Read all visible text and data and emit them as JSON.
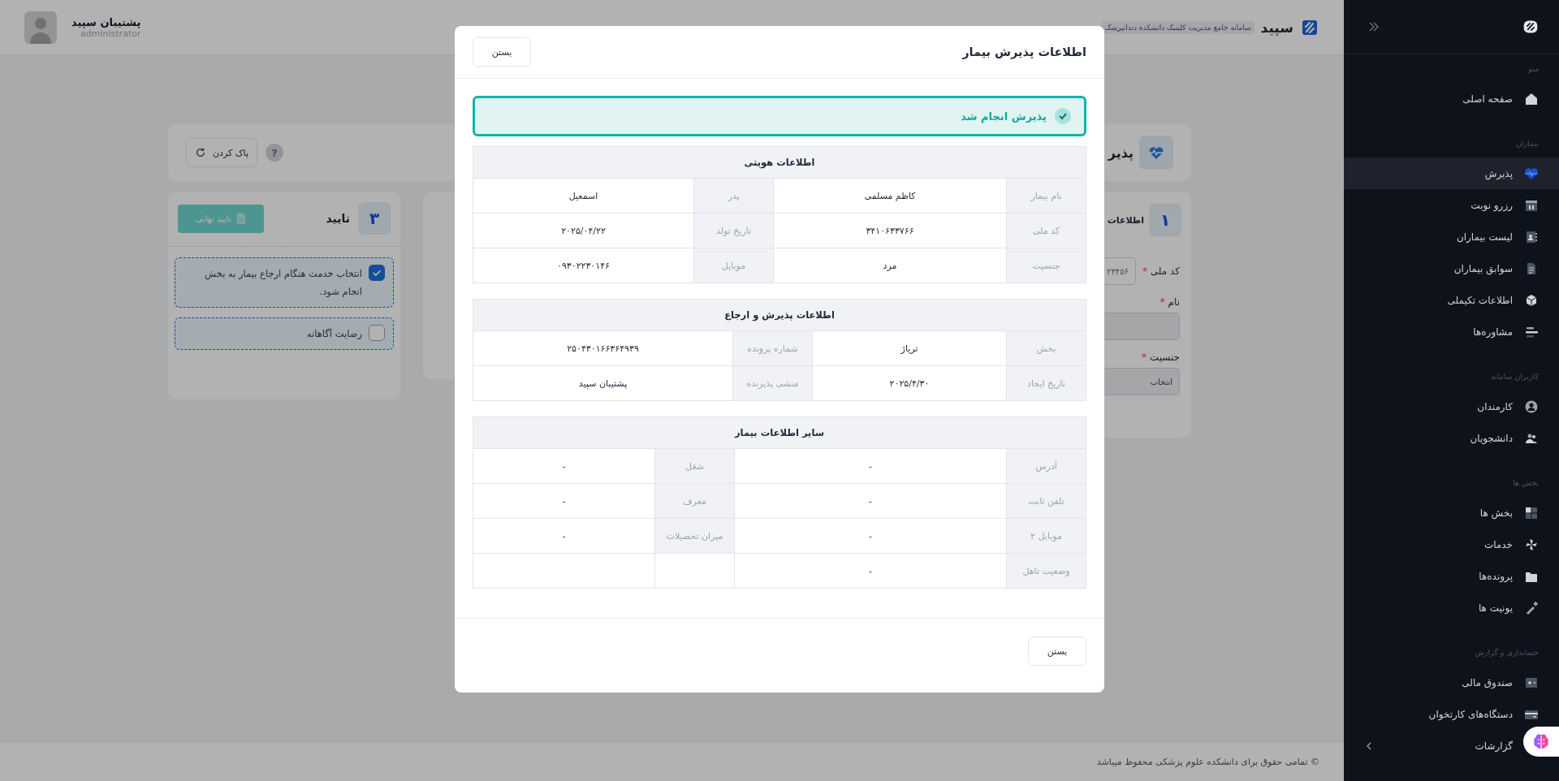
{
  "header": {
    "brand": "سپید",
    "subtitle": "سامانه جامع مدیریت کلینیک دانشکده دندانپزشک",
    "user_name": "پشتیبان سپید",
    "user_role": "administrator"
  },
  "page": {
    "title": "پذیر",
    "help": "?",
    "reset_button": "پاک کردن"
  },
  "step_confirm": {
    "number": "۳",
    "title": "تایید",
    "button": "تایید نهایی",
    "options": [
      {
        "label": "انتخاب خدمت هنگام ارجاع بیمار به بخش انجام شود.",
        "checked": true
      },
      {
        "label": "رضایت آگاهانه",
        "checked": false
      }
    ]
  },
  "step_info": {
    "number": "۱",
    "title": "اطلاعات",
    "fields": [
      {
        "kind": "inline",
        "label": "کد ملی",
        "mark": "*",
        "placeholder": "۲۳۴۵۶"
      },
      {
        "kind": "input",
        "label": "نام",
        "mark": "*"
      },
      {
        "kind": "select",
        "label": "جنسیت",
        "mark": "*",
        "value": "انتخاب"
      }
    ]
  },
  "footer": "© تمامی حقوق برای دانشکده علوم پزشکی محفوظ میباشد",
  "sidebar": {
    "sections": [
      {
        "label": "منو",
        "items": [
          {
            "label": "صفحه اصلی",
            "selected": false
          }
        ]
      },
      {
        "label": "بیماران",
        "items": [
          {
            "label": "پذیرش",
            "selected": true
          },
          {
            "label": "رزرو نوبت",
            "selected": false
          },
          {
            "label": "لیست بیماران",
            "selected": false
          },
          {
            "label": "سوابق بیماران",
            "selected": false
          },
          {
            "label": "اطلاعات تکیملی",
            "selected": false
          },
          {
            "label": "مشاوره‌ها",
            "selected": false
          }
        ]
      },
      {
        "label": "کاربران سامانه",
        "items": [
          {
            "label": "کارمندان",
            "selected": false
          },
          {
            "label": "دانشجویان",
            "selected": false
          }
        ]
      },
      {
        "label": "بخش ها",
        "items": [
          {
            "label": "بخش ها",
            "selected": false
          },
          {
            "label": "خدمات",
            "selected": false
          },
          {
            "label": "پرونده‌ها",
            "selected": false
          },
          {
            "label": "یونیت ها",
            "selected": false
          }
        ]
      },
      {
        "label": "حسابداری و گزارش",
        "items": [
          {
            "label": "صندوق مالی",
            "selected": false
          },
          {
            "label": "دستگاه‌های کارتخوان",
            "selected": false
          },
          {
            "label": "گزارشات",
            "selected": false
          }
        ]
      }
    ]
  },
  "modal": {
    "title": "اطلاعات پذیرش بیمار",
    "close_button": "بستن",
    "status": "پذیرش انجام شد",
    "sections": [
      {
        "title": "اطلاعات هویتی",
        "rows": [
          [
            {
              "label": "نام بیمار",
              "value": "کاظم مسلمی"
            },
            {
              "label": "پدر",
              "value": "اسمعیل"
            }
          ],
          [
            {
              "label": "کد ملی",
              "value": "۳۴۱۰۶۳۳۷۶۶"
            },
            {
              "label": "تاریخ تولد",
              "value": "۲۰۲۵/۰۴/۲۲"
            }
          ],
          [
            {
              "label": "جنسیت",
              "value": "مرد"
            },
            {
              "label": "موبایل",
              "value": "۰۹۳۰۲۲۳۰۱۴۶"
            }
          ]
        ]
      },
      {
        "title": "اطلاعات پذیرش و ارجاع",
        "rows": [
          [
            {
              "label": "بخش",
              "value": "تریاژ"
            },
            {
              "label": "شماره پرونده",
              "value": "۲۵۰۴۳۰۱۶۶۳۶۴۹۳۹"
            }
          ],
          [
            {
              "label": "تاریخ ایجاد",
              "value": "۲۰۲۵/۴/۳۰"
            },
            {
              "label": "منشی پذیرنده",
              "value": "پشتیبان سپید"
            }
          ]
        ]
      },
      {
        "title": "سایر اطلاعات بیمار",
        "rows": [
          [
            {
              "label": "آدرس",
              "value": "-"
            },
            {
              "label": "شغل",
              "value": "-"
            }
          ],
          [
            {
              "label": "تلفن ثابت",
              "value": "-"
            },
            {
              "label": "معرف",
              "value": "-"
            }
          ],
          [
            {
              "label": "موبایل ۲",
              "value": "-"
            },
            {
              "label": "میزان تحصیلات",
              "value": "-"
            }
          ],
          [
            {
              "label": "وضعیت تاهل",
              "value": "-"
            }
          ]
        ]
      }
    ],
    "footer_button": "بستن"
  }
}
